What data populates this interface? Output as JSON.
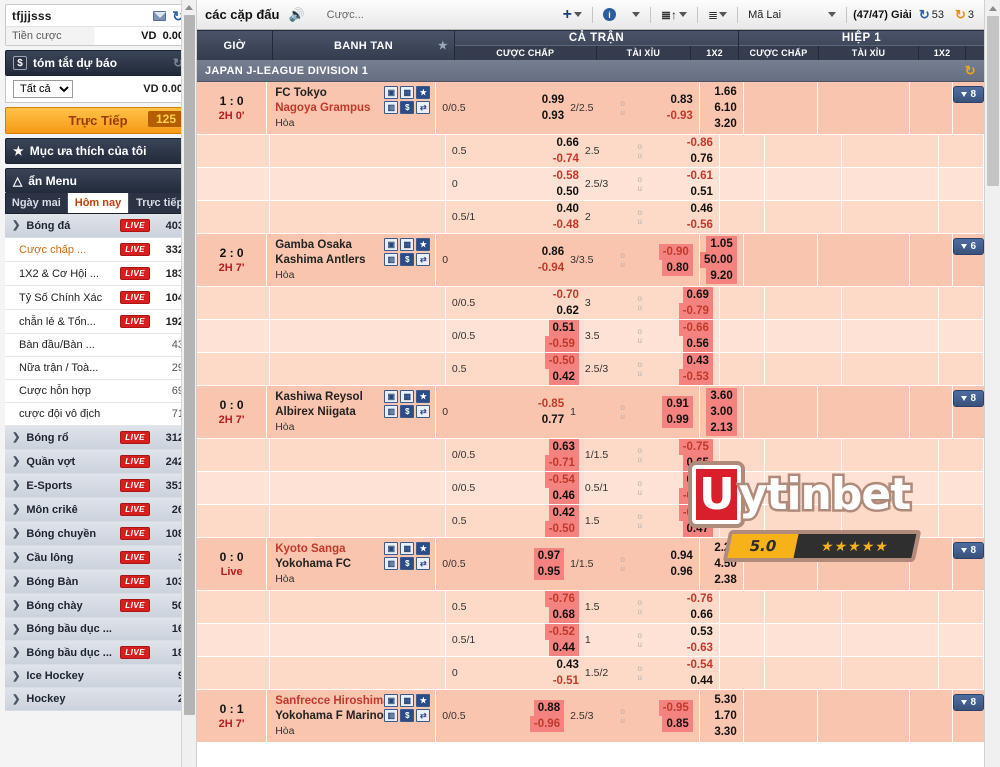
{
  "sidebar": {
    "account": {
      "username": "tfjjjsss",
      "balance_label": "Tiền cược",
      "currency": "VD",
      "balance": "0.00",
      "mail_icon": "envelope-icon",
      "refresh_icon": "refresh-icon"
    },
    "forecast": {
      "title": "tóm tắt dự báo",
      "money_icon": "dollar-icon",
      "refresh_icon": "refresh-icon",
      "filter_value": "Tất cả",
      "filter_options": [
        "Tất cả"
      ],
      "currency": "VD",
      "amount": "0.00"
    },
    "live_button": {
      "label": "Trực Tiếp",
      "count": "125"
    },
    "favorites": {
      "label": "Mục ưa thích của tôi",
      "icon": "star-icon"
    },
    "menu_toggle": {
      "label": "ẩn Menu",
      "icon": "chevron-up-icon"
    },
    "tabs": [
      {
        "label": "Ngày mai",
        "active": false
      },
      {
        "label": "Hôm nay",
        "active": true
      },
      {
        "label": "Trực tiếp",
        "active": false
      }
    ],
    "sports": [
      {
        "type": "sport",
        "label": "Bóng đá",
        "live": true,
        "count": "403"
      },
      {
        "type": "sub",
        "label": "Cược chấp ...",
        "live": true,
        "count": "332",
        "selected": true
      },
      {
        "type": "sub",
        "label": "1X2 & Cơ Hội ...",
        "live": true,
        "count": "183",
        "selected": false
      },
      {
        "type": "sub",
        "label": "Tỷ Số Chính Xác",
        "live": true,
        "count": "104",
        "selected": false
      },
      {
        "type": "sub",
        "label": "chẵn lẻ & Tổn...",
        "live": true,
        "count": "192",
        "selected": false
      },
      {
        "type": "sub",
        "label": "Bàn đầu/Bàn ...",
        "live": false,
        "count": "43",
        "selected": false
      },
      {
        "type": "sub",
        "label": "Nữa trận / Toà...",
        "live": false,
        "count": "29",
        "selected": false
      },
      {
        "type": "sub",
        "label": "Cược hỗn hợp",
        "live": false,
        "count": "69",
        "selected": false
      },
      {
        "type": "sub",
        "label": "cược đội vô địch",
        "live": false,
        "count": "71",
        "selected": false
      },
      {
        "type": "sport",
        "label": "Bóng rổ",
        "live": true,
        "count": "312"
      },
      {
        "type": "sport",
        "label": "Quần vợt",
        "live": true,
        "count": "242"
      },
      {
        "type": "sport",
        "label": "E-Sports",
        "live": true,
        "count": "351"
      },
      {
        "type": "sport",
        "label": "Môn crikê",
        "live": true,
        "count": "26"
      },
      {
        "type": "sport",
        "label": "Bóng chuyền",
        "live": true,
        "count": "108"
      },
      {
        "type": "sport",
        "label": "Cầu lông",
        "live": true,
        "count": "3"
      },
      {
        "type": "sport",
        "label": "Bóng Bàn",
        "live": true,
        "count": "103"
      },
      {
        "type": "sport",
        "label": "Bóng chày",
        "live": true,
        "count": "50"
      },
      {
        "type": "sport",
        "label": "Bóng bầu dục ...",
        "live": false,
        "count": "16"
      },
      {
        "type": "sport",
        "label": "Bóng bầu dục ...",
        "live": true,
        "count": "18"
      },
      {
        "type": "sport",
        "label": "Ice Hockey",
        "live": false,
        "count": "9"
      },
      {
        "type": "sport",
        "label": "Hockey",
        "live": false,
        "count": "2"
      }
    ],
    "live_tag": "LIVE"
  },
  "toolbar": {
    "title": "các cặp đấu",
    "speaker_icon": "speaker-icon",
    "subtitle": "Cược...",
    "add_icon": "plus-icon",
    "info_icon": "info-icon",
    "sort_icon": "sort-icon",
    "list_icon": "list-icon",
    "odds_format": "Mã Lai",
    "odds_options": [
      "Mã Lai"
    ],
    "leagues_label": "(47/47)",
    "leagues_word": "Giải",
    "refresh_blue_icon": "refresh-icon",
    "refresh_blue_value": "53",
    "refresh_orange_icon": "refresh-icon",
    "refresh_orange_value": "3"
  },
  "table": {
    "headers": {
      "time": "GIỜ",
      "match": "BANH TAN",
      "fav_icon": "star-icon",
      "full_match": "CẢ TRẬN",
      "first_half": "HIỆP 1",
      "handicap": "CƯỢC CHẤP",
      "over_under": "TÀI XỈU",
      "one_x_two": "1X2"
    },
    "league": {
      "name": "JAPAN J-LEAGUE DIVISION 1",
      "refresh_icon": "refresh-icon"
    },
    "row_icons": [
      "tv-icon",
      "pitch-icon",
      "star-icon",
      "stats-icon",
      "dollar-icon",
      "h2h-icon"
    ],
    "draw_label": "Hòa",
    "over_mark": "o",
    "under_mark": "u",
    "matches": [
      {
        "score": "1 : 0",
        "minute": "2H 0'",
        "home": "FC Tokyo",
        "away": "Nagoya Grampus",
        "home_red": false,
        "away_red": true,
        "badge": "8",
        "main": {
          "hdp": "0/0.5",
          "hdp_odds": [
            {
              "v": "0.99",
              "neg": false,
              "hl": false
            },
            {
              "v": "0.93",
              "neg": false,
              "hl": false
            }
          ],
          "ou_line": "2/2.5",
          "ou_odds": [
            {
              "v": "0.83",
              "neg": false,
              "hl": false
            },
            {
              "v": "-0.93",
              "neg": true,
              "hl": false
            }
          ],
          "x2": [
            {
              "v": "1.66",
              "hl": false
            },
            {
              "v": "6.10",
              "hl": false
            },
            {
              "v": "3.20",
              "hl": false
            }
          ]
        },
        "subs": [
          {
            "hdp": "0.5",
            "hdp_odds": [
              {
                "v": "0.66",
                "neg": false,
                "hl": false
              },
              {
                "v": "-0.74",
                "neg": true,
                "hl": false
              }
            ],
            "ou_line": "2.5",
            "ou_odds": [
              {
                "v": "-0.86",
                "neg": true,
                "hl": false
              },
              {
                "v": "0.76",
                "neg": false,
                "hl": false
              }
            ]
          },
          {
            "hdp": "0",
            "hdp_odds": [
              {
                "v": "-0.58",
                "neg": true,
                "hl": false
              },
              {
                "v": "0.50",
                "neg": false,
                "hl": false
              }
            ],
            "ou_line": "2.5/3",
            "ou_odds": [
              {
                "v": "-0.61",
                "neg": true,
                "hl": false
              },
              {
                "v": "0.51",
                "neg": false,
                "hl": false
              }
            ]
          },
          {
            "hdp": "0.5/1",
            "hdp_odds": [
              {
                "v": "0.40",
                "neg": false,
                "hl": false
              },
              {
                "v": "-0.48",
                "neg": true,
                "hl": false
              }
            ],
            "ou_line": "2",
            "ou_odds": [
              {
                "v": "0.46",
                "neg": false,
                "hl": false
              },
              {
                "v": "-0.56",
                "neg": true,
                "hl": false
              }
            ]
          }
        ]
      },
      {
        "score": "2 : 0",
        "minute": "2H 7'",
        "home": "Gamba Osaka",
        "away": "Kashima Antlers",
        "home_red": false,
        "away_red": false,
        "badge": "6",
        "main": {
          "hdp": "0",
          "hdp_odds": [
            {
              "v": "0.86",
              "neg": false,
              "hl": false
            },
            {
              "v": "-0.94",
              "neg": true,
              "hl": false
            }
          ],
          "ou_line": "3/3.5",
          "ou_odds": [
            {
              "v": "-0.90",
              "neg": true,
              "hl": true
            },
            {
              "v": "0.80",
              "neg": false,
              "hl": true
            }
          ],
          "x2": [
            {
              "v": "1.05",
              "hl": true
            },
            {
              "v": "50.00",
              "hl": true
            },
            {
              "v": "9.20",
              "hl": true
            }
          ]
        },
        "subs": [
          {
            "hdp": "0/0.5",
            "hdp_odds": [
              {
                "v": "-0.70",
                "neg": true,
                "hl": false
              },
              {
                "v": "0.62",
                "neg": false,
                "hl": false
              }
            ],
            "ou_line": "3",
            "ou_odds": [
              {
                "v": "0.69",
                "neg": false,
                "hl": true
              },
              {
                "v": "-0.79",
                "neg": true,
                "hl": true
              }
            ]
          },
          {
            "hdp": "0/0.5",
            "hdp_odds": [
              {
                "v": "0.51",
                "neg": false,
                "hl": true
              },
              {
                "v": "-0.59",
                "neg": true,
                "hl": true
              }
            ],
            "ou_line": "3.5",
            "ou_odds": [
              {
                "v": "-0.66",
                "neg": true,
                "hl": true
              },
              {
                "v": "0.56",
                "neg": false,
                "hl": true
              }
            ]
          },
          {
            "hdp": "0.5",
            "hdp_odds": [
              {
                "v": "-0.50",
                "neg": true,
                "hl": true
              },
              {
                "v": "0.42",
                "neg": false,
                "hl": true
              }
            ],
            "ou_line": "2.5/3",
            "ou_odds": [
              {
                "v": "0.43",
                "neg": false,
                "hl": true
              },
              {
                "v": "-0.53",
                "neg": true,
                "hl": true
              }
            ]
          }
        ]
      },
      {
        "score": "0 : 0",
        "minute": "2H 7'",
        "home": "Kashiwa Reysol",
        "away": "Albirex Niigata",
        "home_red": false,
        "away_red": false,
        "badge": "8",
        "main": {
          "hdp": "0",
          "hdp_odds": [
            {
              "v": "-0.85",
              "neg": true,
              "hl": false
            },
            {
              "v": "0.77",
              "neg": false,
              "hl": false
            }
          ],
          "ou_line": "1",
          "ou_odds": [
            {
              "v": "0.91",
              "neg": false,
              "hl": true
            },
            {
              "v": "0.99",
              "neg": false,
              "hl": true
            }
          ],
          "x2": [
            {
              "v": "3.60",
              "hl": true
            },
            {
              "v": "3.00",
              "hl": true
            },
            {
              "v": "2.13",
              "hl": true
            }
          ]
        },
        "subs": [
          {
            "hdp": "0/0.5",
            "hdp_odds": [
              {
                "v": "0.63",
                "neg": false,
                "hl": true
              },
              {
                "v": "-0.71",
                "neg": true,
                "hl": true
              }
            ],
            "ou_line": "1/1.5",
            "ou_odds": [
              {
                "v": "-0.75",
                "neg": true,
                "hl": true
              },
              {
                "v": "0.65",
                "neg": false,
                "hl": true
              }
            ]
          },
          {
            "hdp": "0/0.5",
            "hdp_odds": [
              {
                "v": "-0.54",
                "neg": true,
                "hl": true
              },
              {
                "v": "0.46",
                "neg": false,
                "hl": true
              }
            ],
            "ou_line": "0.5/1",
            "ou_odds": [
              {
                "v": "0.54",
                "neg": false,
                "hl": true
              },
              {
                "v": "-0.64",
                "neg": true,
                "hl": true
              }
            ]
          },
          {
            "hdp": "0.5",
            "hdp_odds": [
              {
                "v": "0.42",
                "neg": false,
                "hl": true
              },
              {
                "v": "-0.50",
                "neg": true,
                "hl": true
              }
            ],
            "ou_line": "1.5",
            "ou_odds": [
              {
                "v": "-0.57",
                "neg": true,
                "hl": true
              },
              {
                "v": "0.47",
                "neg": false,
                "hl": true
              }
            ]
          }
        ]
      },
      {
        "score": "0 : 0",
        "minute": "Live",
        "home": "Kyoto Sanga",
        "away": "Yokohama FC",
        "home_red": true,
        "away_red": false,
        "badge": "8",
        "main": {
          "hdp": "0/0.5",
          "hdp_odds": [
            {
              "v": "0.97",
              "neg": false,
              "hl": true
            },
            {
              "v": "0.95",
              "neg": false,
              "hl": true
            }
          ],
          "ou_line": "1/1.5",
          "ou_odds": [
            {
              "v": "0.94",
              "neg": false,
              "hl": false
            },
            {
              "v": "0.96",
              "neg": false,
              "hl": false
            }
          ],
          "x2": [
            {
              "v": "2.28",
              "hl": false
            },
            {
              "v": "4.50",
              "hl": false
            },
            {
              "v": "2.38",
              "hl": false
            }
          ]
        },
        "subs": [
          {
            "hdp": "0.5",
            "hdp_odds": [
              {
                "v": "-0.76",
                "neg": true,
                "hl": true
              },
              {
                "v": "0.68",
                "neg": false,
                "hl": true
              }
            ],
            "ou_line": "1.5",
            "ou_odds": [
              {
                "v": "-0.76",
                "neg": true,
                "hl": false
              },
              {
                "v": "0.66",
                "neg": false,
                "hl": false
              }
            ]
          },
          {
            "hdp": "0.5/1",
            "hdp_odds": [
              {
                "v": "-0.52",
                "neg": true,
                "hl": true
              },
              {
                "v": "0.44",
                "neg": false,
                "hl": true
              }
            ],
            "ou_line": "1",
            "ou_odds": [
              {
                "v": "0.53",
                "neg": false,
                "hl": false
              },
              {
                "v": "-0.63",
                "neg": true,
                "hl": false
              }
            ]
          },
          {
            "hdp": "0",
            "hdp_odds": [
              {
                "v": "0.43",
                "neg": false,
                "hl": false
              },
              {
                "v": "-0.51",
                "neg": true,
                "hl": false
              }
            ],
            "ou_line": "1.5/2",
            "ou_odds": [
              {
                "v": "-0.54",
                "neg": true,
                "hl": false
              },
              {
                "v": "0.44",
                "neg": false,
                "hl": false
              }
            ]
          }
        ]
      },
      {
        "score": "0 : 1",
        "minute": "2H 7'",
        "home": "Sanfrecce Hiroshima",
        "away": "Yokohama F Marinos",
        "home_red": true,
        "away_red": false,
        "badge": "8",
        "main": {
          "hdp": "0/0.5",
          "hdp_odds": [
            {
              "v": "0.88",
              "neg": false,
              "hl": true
            },
            {
              "v": "-0.96",
              "neg": true,
              "hl": true
            }
          ],
          "ou_line": "2.5/3",
          "ou_odds": [
            {
              "v": "-0.95",
              "neg": true,
              "hl": true
            },
            {
              "v": "0.85",
              "neg": false,
              "hl": true
            }
          ],
          "x2": [
            {
              "v": "5.30",
              "hl": false
            },
            {
              "v": "1.70",
              "hl": false
            },
            {
              "v": "3.30",
              "hl": false
            }
          ]
        },
        "subs": []
      }
    ]
  },
  "watermark": {
    "brand": "Uytinbet",
    "first_letter": "U",
    "rest": "ytinbet",
    "score": "5.0",
    "stars": "★★★★★"
  },
  "colors": {
    "accent_orange": "#f79a14",
    "live_red": "#d81f1f",
    "row_pink": "#f9c5ae",
    "highlight_red": "#f4837f",
    "header_navy": "#343c4e",
    "negative_red": "#c0392b"
  }
}
